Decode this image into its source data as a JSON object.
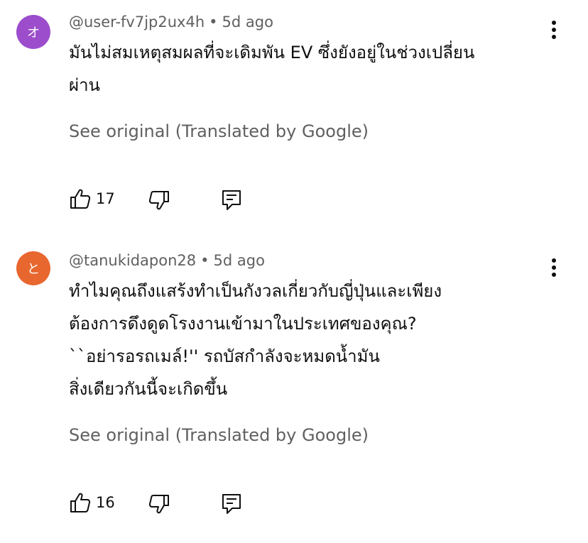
{
  "colors": {
    "avatar_1": "#9c4dcc",
    "avatar_2": "#e8672f",
    "secondary_text": "#606060",
    "primary_text": "#0f0f0f"
  },
  "comments": [
    {
      "avatar_letter": "オ",
      "author": "@user-fv7jp2ux4h",
      "separator": "•",
      "time": "5d ago",
      "lines": [
        "มันไม่สมเหตุสมผลที่จะเดิมพัน EV ซึ่งยังอยู่ในช่วงเปลี่ยน",
        "ผ่าน"
      ],
      "see_original": "See original (Translated by Google)",
      "likes": "17",
      "icons": [
        "thumbs-up-icon",
        "thumbs-down-icon",
        "reply-icon",
        "more-vert-icon"
      ]
    },
    {
      "avatar_letter": "と",
      "author": "@tanukidapon28",
      "separator": "•",
      "time": "5d ago",
      "lines": [
        "ทำไมคุณถึงแสร้งทำเป็นกังวลเกี่ยวกับญี่ปุ่นและเพียง",
        "ต้องการดึงดูดโรงงานเข้ามาในประเทศของคุณ?",
        "``อย่ารอรถเมล์!'' รถบัสกำลังจะหมดน้ำมัน",
        "สิ่งเดียวกันนี้จะเกิดขึ้น"
      ],
      "see_original": "See original (Translated by Google)",
      "likes": "16",
      "icons": [
        "thumbs-up-icon",
        "thumbs-down-icon",
        "reply-icon",
        "more-vert-icon"
      ]
    }
  ]
}
